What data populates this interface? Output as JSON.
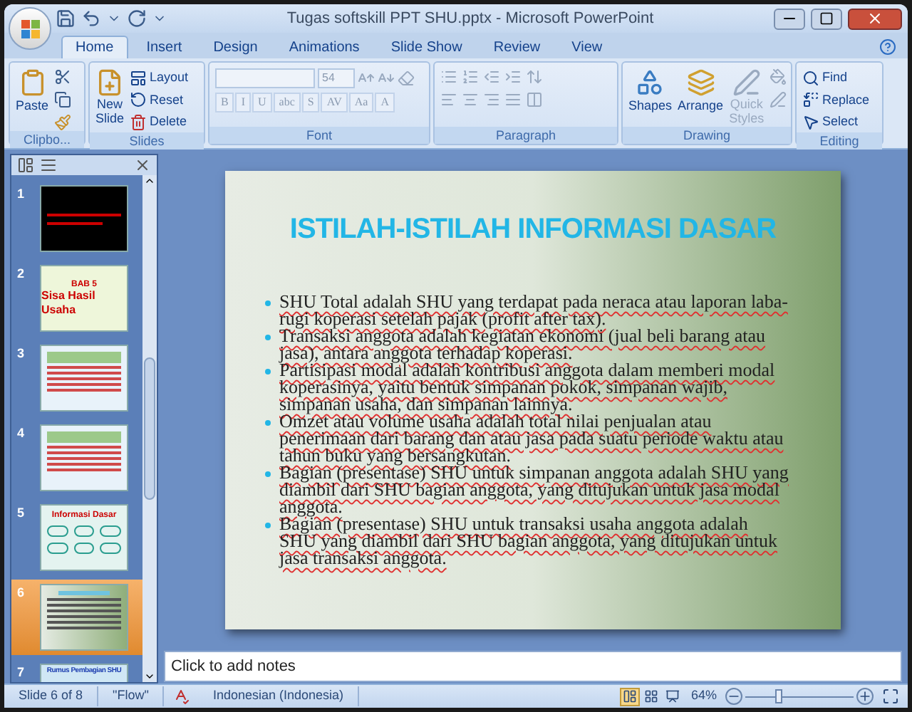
{
  "window": {
    "title": "Tugas softskill PPT SHU.pptx - Microsoft PowerPoint"
  },
  "tabs": [
    {
      "label": "Home",
      "selected": true
    },
    {
      "label": "Insert",
      "selected": false
    },
    {
      "label": "Design",
      "selected": false
    },
    {
      "label": "Animations",
      "selected": false
    },
    {
      "label": "Slide Show",
      "selected": false
    },
    {
      "label": "Review",
      "selected": false
    },
    {
      "label": "View",
      "selected": false
    }
  ],
  "ribbon": {
    "clipboard": {
      "label": "Clipbo...",
      "paste": "Paste"
    },
    "slides": {
      "label": "Slides",
      "new_slide": [
        "New",
        "Slide"
      ],
      "layout": "Layout",
      "reset": "Reset",
      "delete": "Delete"
    },
    "font": {
      "label": "Font",
      "font_size": "54",
      "format_buttons": [
        "B",
        "I",
        "U",
        "abc",
        "S",
        "AV",
        "Aa",
        "A"
      ]
    },
    "paragraph": {
      "label": "Paragraph"
    },
    "drawing": {
      "label": "Drawing",
      "shapes": "Shapes",
      "arrange": "Arrange",
      "quick_styles": [
        "Quick",
        "Styles"
      ],
      "quick_styles_disabled": true
    },
    "editing": {
      "label": "Editing",
      "find": "Find",
      "replace": "Replace",
      "select": "Select"
    }
  },
  "thumbnails": [
    {
      "number": "1",
      "selected": false,
      "kind": "dark"
    },
    {
      "number": "2",
      "selected": false,
      "kind": "hand",
      "heading": "BAB 5",
      "title": "Sisa Hasil Usaha"
    },
    {
      "number": "3",
      "selected": false,
      "kind": "text"
    },
    {
      "number": "4",
      "selected": false,
      "kind": "text"
    },
    {
      "number": "5",
      "selected": false,
      "kind": "diagram",
      "title": "Informasi Dasar"
    },
    {
      "number": "6",
      "selected": true,
      "kind": "forest"
    },
    {
      "number": "7",
      "selected": false,
      "kind": "partial",
      "title": "Rumus Pembagian SHU"
    }
  ],
  "slide": {
    "title": "ISTILAH-ISTILAH INFORMASI DASAR",
    "spelling_marked": true,
    "bullets": [
      "SHU Total adalah SHU yang terdapat pada neraca atau laporan laba-rugi koperasi setelah pajak (profit after tax).",
      "Transaksi anggota adalah kegiatan ekonomi (jual beli barang atau jasa), antara anggota terhadap koperasi.",
      "Partisipasi modal adalah kontribusi anggota dalam memberi modal koperasinya, yaitu bentuk simpanan pokok, simpanan wajib, simpanan usaha, dan simpanan lainnya.",
      "Omzet atau volume usaha adalah total nilai penjualan atau penerimaan dari barang dan atau jasa pada suatu periode waktu atau tahun buku yang bersangkutan.",
      "Bagian (presentase) SHU untuk simpanan anggota adalah SHU yang diambil dari SHU bagian anggota, yang ditujukan untuk jasa modal anggota.",
      "Bagian (presentase) SHU untuk transaksi usaha anggota adalah SHU yang diambil dari SHU bagian anggota, yang ditujukan untuk jasa transaksi anggota."
    ]
  },
  "notes": {
    "placeholder": "Click to add notes"
  },
  "status_bar": {
    "slide": "Slide 6 of 8",
    "theme": "\"Flow\"",
    "language": "Indonesian (Indonesia)",
    "views": [
      {
        "kind": "normal",
        "selected": true
      },
      {
        "kind": "sorter",
        "selected": false
      },
      {
        "kind": "show",
        "selected": false
      }
    ],
    "zoom": "64%",
    "zoom_level": {
      "level": 0.3
    }
  }
}
